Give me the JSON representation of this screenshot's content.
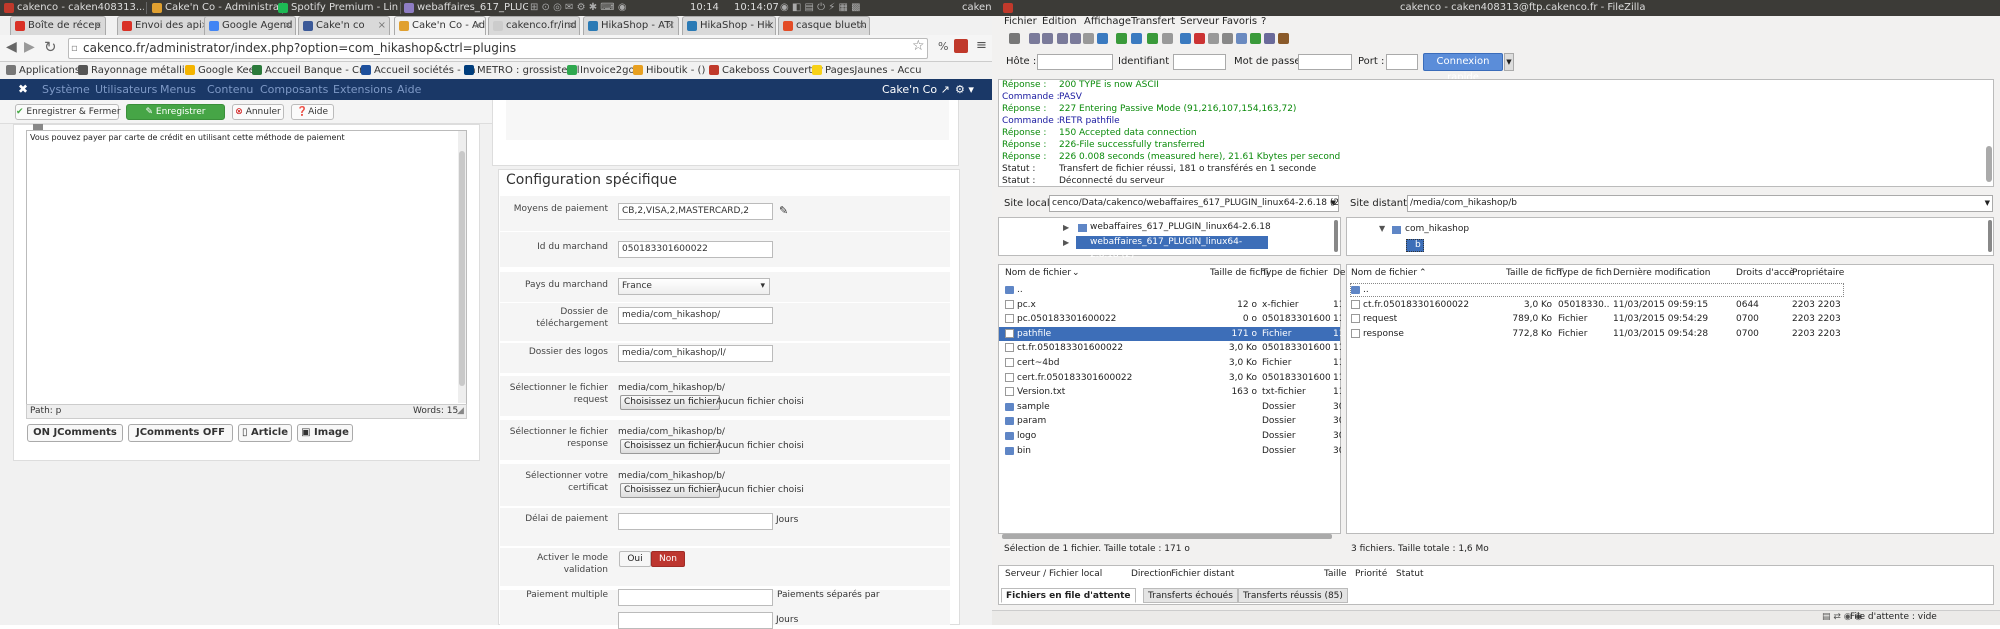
{
  "taskbar": {
    "tabs": [
      {
        "label": "cakenco - caken408313...",
        "color": "#c0392b"
      },
      {
        "label": "Cake'n Co - Administrat...",
        "color": "#e0a030"
      },
      {
        "label": "Spotify Premium - Linu...",
        "color": "#1db954"
      },
      {
        "label": "webaffaires_617_PLUGI...",
        "color": "#8e7cc3"
      }
    ],
    "time1": "10:14",
    "time2": "10:14:07",
    "right_title": "cakenco"
  },
  "browser": {
    "tabs": [
      {
        "label": "Boîte de récep",
        "color": "#d93025"
      },
      {
        "label": "Envoi des api",
        "color": "#d93025"
      },
      {
        "label": "Google Agend",
        "color": "#4285f4"
      },
      {
        "label": "Cake'n co",
        "color": "#3b5998"
      },
      {
        "label": "Cake'n Co - Adi",
        "color": "#e0a030"
      },
      {
        "label": "cakenco.fr/ind",
        "color": "#cccccc"
      },
      {
        "label": "HikaShop - ATI",
        "color": "#2a7ab5"
      },
      {
        "label": "HikaShop - Hik",
        "color": "#2a7ab5"
      },
      {
        "label": "casque blueth",
        "color": "#e34c26"
      }
    ],
    "url": "cakenco.fr/administrator/index.php?option=com_hikashop&ctrl=plugins",
    "bookmarks": [
      {
        "label": "Applications",
        "color": "#777"
      },
      {
        "label": "Rayonnage métallic",
        "color": "#555"
      },
      {
        "label": "Google Keep",
        "color": "#f4b400"
      },
      {
        "label": "Accueil Banque - Cr",
        "color": "#2b7a3b"
      },
      {
        "label": "Accueil sociétés - Pa",
        "color": "#1d4f9c"
      },
      {
        "label": "METRO : grossiste al",
        "color": "#003d7c"
      },
      {
        "label": "Invoice2go",
        "color": "#2fa84f"
      },
      {
        "label": "Hiboutik - () -",
        "color": "#e8a020"
      },
      {
        "label": "Cakeboss Couvertur",
        "color": "#c0392b"
      },
      {
        "label": "PagesJaunes - Accu",
        "color": "#f7d117"
      }
    ]
  },
  "joomla": {
    "menu": [
      "Système",
      "Utilisateurs",
      "Menus",
      "Contenu",
      "Composants",
      "Extensions",
      "Aide"
    ],
    "site_name": "Cake'n Co ↗",
    "toolbar": {
      "save_close": "Enregistrer & Fermer",
      "save": "Enregistrer",
      "cancel": "Annuler",
      "help": "Aide"
    },
    "editor_text": "Vous pouvez payer par carte de crédit en utilisant cette méthode de paiement",
    "editor_path": "Path:  p",
    "editor_words": "Words: 15",
    "editor_buttons": [
      "ON JComments",
      "JComments OFF",
      "Article",
      "Image"
    ],
    "config": {
      "title": "Configuration spécifique",
      "moyens_label": "Moyens de paiement",
      "moyens_value": "CB,2,VISA,2,MASTERCARD,2",
      "marchand_label": "Id du marchand",
      "marchand_value": "050183301600022",
      "pays_label": "Pays du marchand",
      "pays_value": "France",
      "dossier_dl_label": "Dossier de téléchargement",
      "dossier_dl_value": "media/com_hikashop/",
      "logos_label": "Dossier des logos",
      "logos_value": "media/com_hikashop/l/",
      "req_label": "Sélectionner le fichier request",
      "req_path": "media/com_hikashop/b/",
      "resp_label": "Sélectionner le fichier response",
      "resp_path": "media/com_hikashop/b/",
      "cert_label": "Sélectionner votre certificat",
      "cert_path": "media/com_hikashop/b/",
      "file_btn": "Choisissez un fichier",
      "no_file": "Aucun fichier choisi",
      "delai_label": "Délai de paiement",
      "delai_unit": "Jours",
      "validation_label": "Activer le mode validation",
      "oui": "Oui",
      "non": "Non",
      "multiple_label": "Paiement multiple",
      "multiple_unit": "Paiements séparés par",
      "multiple_unit2": "Jours"
    }
  },
  "filezilla": {
    "title": "cakenco - caken408313@ftp.cakenco.fr - FileZilla",
    "menu": [
      "Fichier",
      "Édition",
      "Affichage",
      "Transfert",
      "Serveur",
      "Favoris",
      "?"
    ],
    "quickconnect": {
      "host": "Hôte :",
      "user": "Identifiant :",
      "pass": "Mot de passe :",
      "port": "Port :",
      "button": "Connexion rapide"
    },
    "log": [
      {
        "k": "Réponse :",
        "v": "200 TYPE is now ASCII",
        "c": "g"
      },
      {
        "k": "Commande :",
        "v": "PASV",
        "c": "bl"
      },
      {
        "k": "Réponse :",
        "v": "227 Entering Passive Mode (91,216,107,154,163,72)",
        "c": "g"
      },
      {
        "k": "Commande :",
        "v": "RETR pathfile",
        "c": "bl"
      },
      {
        "k": "Réponse :",
        "v": "150 Accepted data connection",
        "c": "g"
      },
      {
        "k": "Réponse :",
        "v": "226-File successfully transferred",
        "c": "g"
      },
      {
        "k": "Réponse :",
        "v": "226 0.008 seconds (measured here), 21.61 Kbytes per second",
        "c": "g"
      },
      {
        "k": "Statut :",
        "v": "Transfert de fichier réussi, 181 o transférés en 1 seconde",
        "c": "bk"
      },
      {
        "k": "Statut :",
        "v": "Déconnecté du serveur",
        "c": "bk"
      }
    ],
    "local_site_label": "Site local :",
    "local_site_value": "cenco/Data/cakenco/webaffaires_617_PLUGIN_linux64-2.6.18 (2)/",
    "remote_site_label": "Site distant :",
    "remote_site_value": "/media/com_hikashop/b",
    "local_tree": [
      "webaffaires_617_PLUGIN_linux64-2.6.18",
      "webaffaires_617_PLUGIN_linux64-2.6.18 (2)"
    ],
    "remote_tree": [
      "com_hikashop",
      "b"
    ],
    "local_headers": [
      "Nom de fichier",
      "Taille de fichi",
      "Type de fichier",
      "De"
    ],
    "local_files": [
      {
        "name": "..",
        "size": "",
        "type": "",
        "d": "",
        "kind": "up"
      },
      {
        "name": "pc.x",
        "size": "12 o",
        "type": "x-fichier",
        "d": "11",
        "kind": "file"
      },
      {
        "name": "pc.050183301600022",
        "size": "0 o",
        "type": "050183301600...",
        "d": "11",
        "kind": "file"
      },
      {
        "name": "pathfile",
        "size": "171 o",
        "type": "Fichier",
        "d": "11",
        "kind": "file",
        "sel": true
      },
      {
        "name": "ct.fr.050183301600022",
        "size": "3,0 Ko",
        "type": "050183301600...",
        "d": "11",
        "kind": "file"
      },
      {
        "name": "cert~4bd",
        "size": "3,0 Ko",
        "type": "Fichier",
        "d": "11",
        "kind": "file"
      },
      {
        "name": "cert.fr.050183301600022",
        "size": "3,0 Ko",
        "type": "050183301600...",
        "d": "11",
        "kind": "file"
      },
      {
        "name": "Version.txt",
        "size": "163 o",
        "type": "txt-fichier",
        "d": "11",
        "kind": "file"
      },
      {
        "name": "sample",
        "size": "",
        "type": "Dossier",
        "d": "30",
        "kind": "dir"
      },
      {
        "name": "param",
        "size": "",
        "type": "Dossier",
        "d": "30",
        "kind": "dir"
      },
      {
        "name": "logo",
        "size": "",
        "type": "Dossier",
        "d": "30",
        "kind": "dir"
      },
      {
        "name": "bin",
        "size": "",
        "type": "Dossier",
        "d": "30",
        "kind": "dir"
      }
    ],
    "remote_headers": [
      "Nom de fichier",
      "Taille de fich",
      "Type de fich",
      "Dernière modification",
      "Droits d'accè",
      "Propriétaire"
    ],
    "remote_files": [
      {
        "name": "..",
        "size": "",
        "type": "",
        "mod": "",
        "perm": "",
        "owner": "",
        "kind": "up"
      },
      {
        "name": "ct.fr.050183301600022",
        "size": "3,0 Ko",
        "type": "05018330...",
        "mod": "11/03/2015 09:59:15",
        "perm": "0644",
        "owner": "2203 2203",
        "kind": "file"
      },
      {
        "name": "request",
        "size": "789,0 Ko",
        "type": "Fichier",
        "mod": "11/03/2015 09:54:29",
        "perm": "0700",
        "owner": "2203 2203",
        "kind": "file"
      },
      {
        "name": "response",
        "size": "772,8 Ko",
        "type": "Fichier",
        "mod": "11/03/2015 09:54:28",
        "perm": "0700",
        "owner": "2203 2203",
        "kind": "file"
      }
    ],
    "local_status": "Sélection de 1 fichier. Taille totale : 171 o",
    "remote_status": "3 fichiers. Taille totale : 1,6 Mo",
    "queue_headers": [
      "Serveur / Fichier local",
      "Direction",
      "Fichier distant",
      "Taille",
      "Priorité",
      "Statut"
    ],
    "queue_tabs": [
      "Fichiers en file d'attente",
      "Transferts échoués",
      "Transferts réussis (85)"
    ],
    "queue_status": "File d'attente : vide"
  }
}
